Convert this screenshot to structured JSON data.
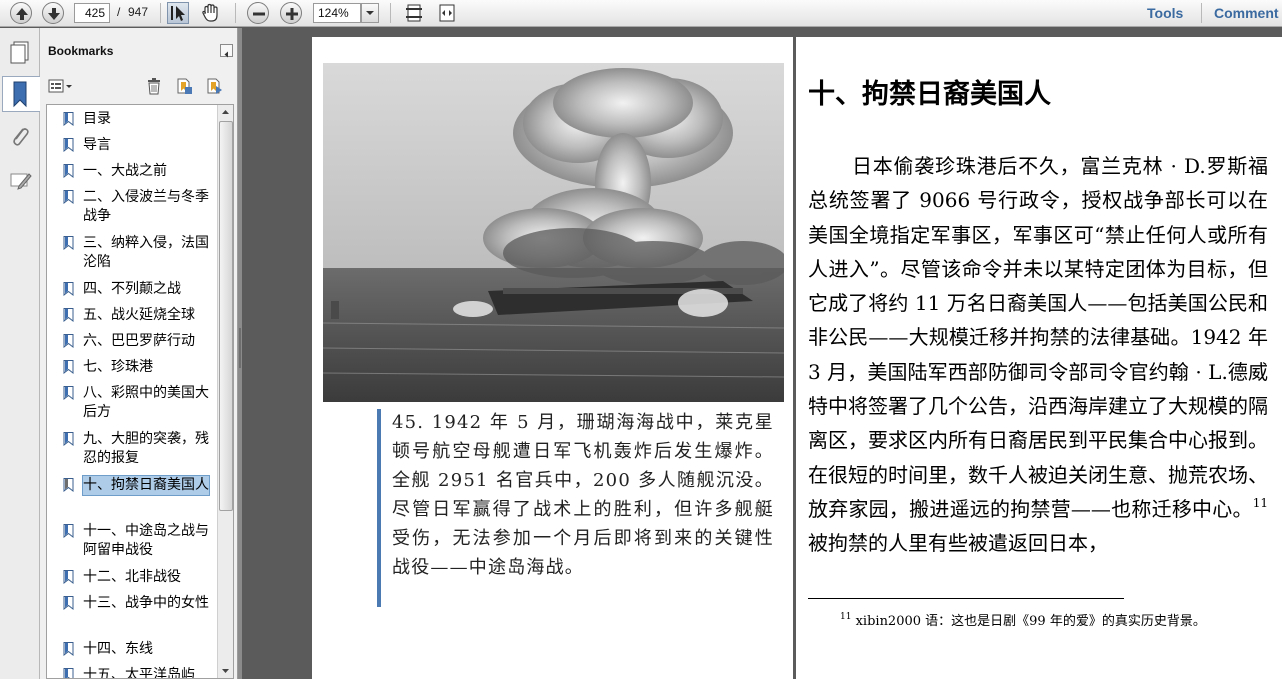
{
  "toolbar": {
    "page_current": "425",
    "page_separator": "/",
    "page_total": "947",
    "zoom_value": "124%",
    "tools_label": "Tools",
    "comment_label": "Comment"
  },
  "bookmarks": {
    "title": "Bookmarks",
    "items": [
      {
        "label": "目录"
      },
      {
        "label": "导言"
      },
      {
        "label": "一、大战之前"
      },
      {
        "label": "二、入侵波兰与冬季战争"
      },
      {
        "label": "三、纳粹入侵，法国沦陷"
      },
      {
        "label": "四、不列颠之战"
      },
      {
        "label": "五、战火延烧全球"
      },
      {
        "label": "六、巴巴罗萨行动"
      },
      {
        "label": "七、珍珠港"
      },
      {
        "label": "八、彩照中的美国大后方"
      },
      {
        "label": "九、大胆的突袭，残忍的报复"
      },
      {
        "label": "十、拘禁日裔美国人"
      },
      {
        "label": "十一、中途岛之战与阿留申战役"
      },
      {
        "label": "十二、北非战役"
      },
      {
        "label": "十三、战争中的女性"
      },
      {
        "label": "十四、东线"
      },
      {
        "label": "十五、太平洋岛屿"
      }
    ]
  },
  "left_page": {
    "caption": "45. 1942 年 5 月，珊瑚海海战中，莱克星顿号航空母舰遭日军飞机轰炸后发生爆炸。全舰 2951 名官兵中，200 多人随舰沉没。尽管日军赢得了战术上的胜利，但许多舰艇受伤，无法参加一个月后即将到来的关键性战役——中途岛海战。"
  },
  "right_page": {
    "chapter_title": "十、拘禁日裔美国人",
    "body": "日本偷袭珍珠港后不久，富兰克林 · D.罗斯福总统签署了 9066 号行政令，授权战争部长可以在美国全境指定军事区，军事区可“禁止任何人或所有人进入”。尽管该命令并未以某特定团体为目标，但它成了将约 11 万名日裔美国人——包括美国公民和非公民——大规模迁移并拘禁的法律基础。1942 年 3 月，美国陆军西部防御司令部司令官约翰 · L.德威特中将签署了几个公告，沿西海岸建立了大规模的隔离区，要求区内所有日裔居民到平民集合中心报到。在很短的时间里，数千人被迫关闭生意、抛荒农场、放弃家园，搬进遥远的拘禁营——也称迁移中心。",
    "body_ref": "11",
    "body_tail": "被拘禁的人里有些被遣返回日本，",
    "footnote_num": "11",
    "footnote_text": "xibin2000 语：这也是日剧《99 年的爱》的真实历史背景。"
  }
}
